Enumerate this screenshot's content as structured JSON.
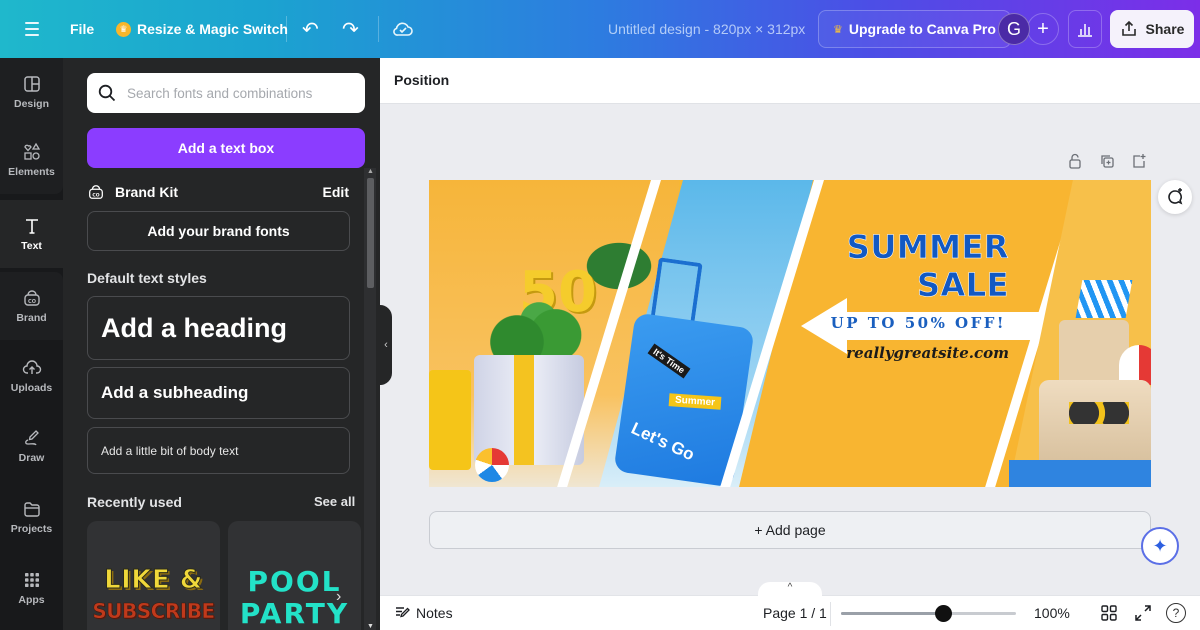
{
  "topbar": {
    "menu_icon": "hamburger-icon",
    "file_label": "File",
    "resize_label": "Resize & Magic Switch",
    "undo_icon": "undo-icon",
    "redo_icon": "redo-icon",
    "cloud_icon": "cloud-save-icon",
    "design_title": "Untitled design - 820px × 312px",
    "upgrade_label": "Upgrade to Canva Pro",
    "avatar_initial": "G",
    "add_member_icon": "plus-icon",
    "analytics_icon": "bar-chart-icon",
    "share_label": "Share",
    "colors": {
      "purple_cta": "#8b3dff",
      "gradient_start": "#1fb8cc",
      "gradient_end": "#7c2ee8"
    }
  },
  "rail": {
    "items": [
      {
        "label": "Design",
        "icon": "layout-icon"
      },
      {
        "label": "Elements",
        "icon": "shapes-icon"
      },
      {
        "label": "Text",
        "icon": "text-icon",
        "active": true
      },
      {
        "label": "Brand",
        "icon": "brand-kit-icon"
      },
      {
        "label": "Uploads",
        "icon": "cloud-upload-icon"
      },
      {
        "label": "Draw",
        "icon": "draw-icon"
      },
      {
        "label": "Projects",
        "icon": "folder-icon"
      },
      {
        "label": "Apps",
        "icon": "apps-grid-icon"
      }
    ]
  },
  "panel": {
    "search_placeholder": "Search fonts and combinations",
    "search_value": "",
    "add_textbox_label": "Add a text box",
    "brand_kit_label": "Brand Kit",
    "brand_edit_label": "Edit",
    "brand_fonts_label": "Add your brand fonts",
    "default_styles_label": "Default text styles",
    "heading_label": "Add a heading",
    "subheading_label": "Add a subheading",
    "body_label": "Add a little bit of body text",
    "recent_label": "Recently used",
    "see_all_label": "See all",
    "recent_items": [
      {
        "line1": "LIKE &",
        "line2": "SUBSCRIBE"
      },
      {
        "line1": "POOL",
        "line2": "PARTY"
      }
    ]
  },
  "canvas": {
    "context_label": "Position",
    "design": {
      "headline_line1": "SUMMER",
      "headline_line2": "SALE",
      "offer": "UP TO 50% OFF!",
      "url": "reallygreatsite.com",
      "number_badge": "50",
      "tag_time": "It's Time",
      "tag_summer": "Summer",
      "tag_go": "Let's Go"
    },
    "add_page_label": "+ Add page"
  },
  "footer": {
    "notes_label": "Notes",
    "page_indicator": "Page 1 / 1",
    "zoom_value": "100%",
    "zoom_slider_fraction": 0.58,
    "help_label": "?"
  }
}
